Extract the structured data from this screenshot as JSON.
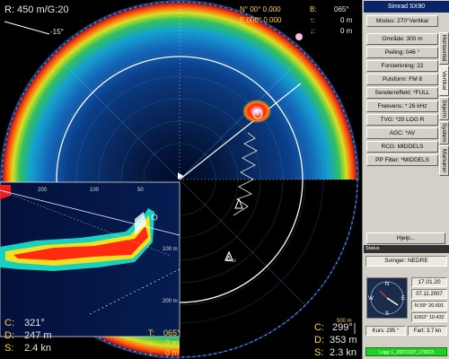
{
  "top_left": {
    "range": "R: 450 m/G:20",
    "tilt": "-15°"
  },
  "top_right": {
    "n_label": "N° 00° 0.000",
    "e_label": "E 000° 0.000",
    "b_label": "B:",
    "b_value": "065°",
    "up_arrow": "↑:",
    "up_value": "0 m",
    "down_arrow": "↓:",
    "down_value": "0 m"
  },
  "bottom_left": {
    "c_label": "C:",
    "c_value": "321°",
    "d_label": "D:",
    "d_value": "247 m",
    "s_label": "S:",
    "s_value": "2.4 kn"
  },
  "bottom_mid": {
    "t_label": "T:",
    "t_value": "065°",
    "up_arrow": "↑:",
    "up_value": "0 m",
    "down_arrow": "↓:",
    "down_value": "0 m"
  },
  "bottom_right": {
    "c_label": "C:",
    "c_value": "299°",
    "d_label": "D:",
    "d_value": "353 m",
    "s_label": "S:",
    "s_value": "2.3 kn"
  },
  "scale_labels": {
    "r500": "500 m",
    "i200": "200 m",
    "i100": "100 m",
    "t100": "100",
    "t200": "200",
    "t50": "50"
  },
  "marker_label": "Δ₁₂",
  "colors": {
    "accent": "#ffd640",
    "panel_bg": "#d4d0c8",
    "title_bg": "#0a246a",
    "status_green": "#20d020"
  },
  "panel": {
    "title": "Simrad SX90",
    "mode": "Modus: 270°Vertikal",
    "buttons": [
      "Område: 300 m",
      "Peiling: 046 °",
      "Forsterkning: 22",
      "Pulsform: FM 8",
      "Senderreffekt: *FULL",
      "Frekvens: * 26 kHz",
      "TVG: *20 LOG R",
      "AGC: *AV",
      "RCG: MIDDELS",
      "PP Filter: *MIDDELS"
    ],
    "tabs": [
      "Horisontal",
      "Vertikal",
      "Skjerm",
      "System",
      "Markører"
    ],
    "help": "Hjelp..."
  },
  "status": {
    "header": "Status",
    "svinger": "Svinger: NEDRE",
    "time": "17.01.20",
    "date": "07.11.2007",
    "lat": "N 59° 20.691",
    "lon": "E002° 10.432",
    "kurs": "Kurs: 295 °",
    "fart": "Fart: 3.7 kn",
    "log": "Logg: L_20071107_170023"
  }
}
